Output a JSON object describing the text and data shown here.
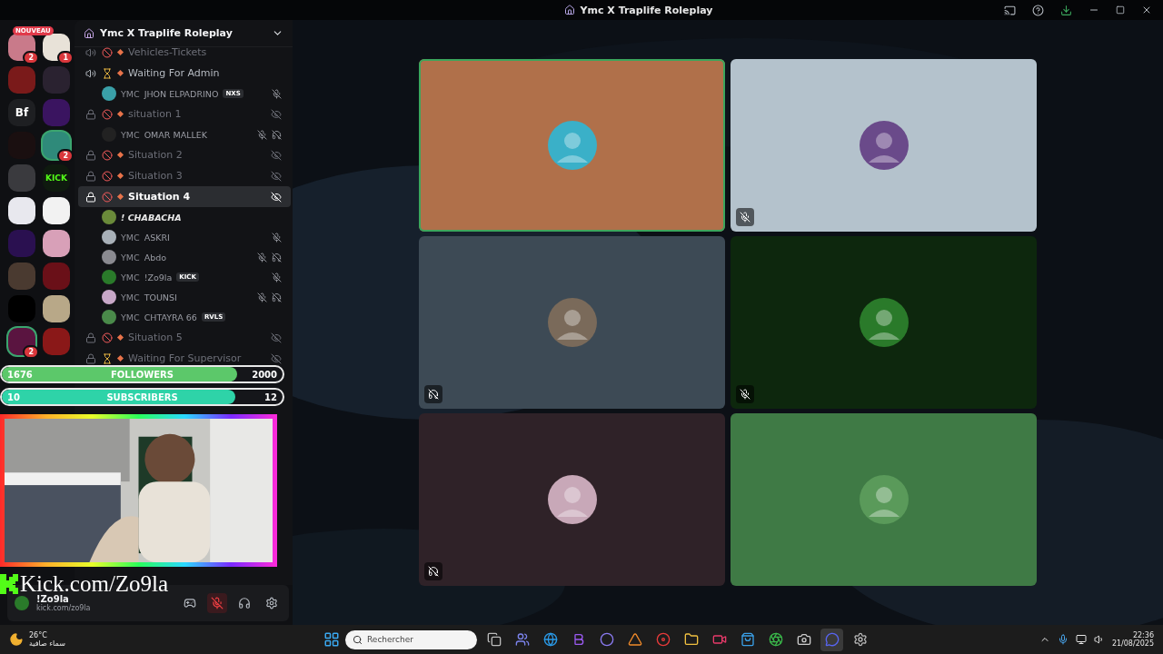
{
  "window": {
    "title": "Ymc X Traplife Roleplay"
  },
  "servers": {
    "new_badge": "NOUVEAU",
    "items": [
      {
        "color": "#c97a8a",
        "badge": "2",
        "highlighted": false
      },
      {
        "color": "#e8e2d8",
        "badge": "1",
        "highlighted": false
      },
      {
        "color": "#7a1a1a",
        "highlighted": false
      },
      {
        "color": "#2a2230",
        "highlighted": false
      },
      {
        "label": "Bf",
        "color": "#1e1f22",
        "highlighted": false
      },
      {
        "color": "#3a1460",
        "highlighted": false
      },
      {
        "color": "#1a0f10",
        "highlighted": false
      },
      {
        "color": "#2f8a7a",
        "badge": "2",
        "highlighted": true
      },
      {
        "color": "#3a3a3e",
        "highlighted": false
      },
      {
        "label": "KICK",
        "color": "#0f1a0f",
        "highlighted": false
      },
      {
        "color": "#e8e8ee",
        "highlighted": false
      },
      {
        "color": "#f2f2f2",
        "highlighted": false
      },
      {
        "color": "#2a1050",
        "highlighted": false
      },
      {
        "color": "#d8a0b8",
        "highlighted": false
      },
      {
        "color": "#4a3a30",
        "highlighted": false
      },
      {
        "color": "#6a1018",
        "highlighted": false
      },
      {
        "color": "#000000",
        "highlighted": false
      },
      {
        "color": "#b8a888",
        "highlighted": false
      },
      {
        "color": "#5a1440",
        "badge": "2",
        "highlighted": true
      },
      {
        "color": "#8a1818",
        "highlighted": false
      }
    ]
  },
  "channel_panel": {
    "title": "Ymc X Traplife Roleplay",
    "rows": [
      {
        "kind": "channel",
        "name": "Vehicles-Tickets",
        "locked": false,
        "waiting": false,
        "selected": false,
        "dim": true
      },
      {
        "kind": "channel",
        "name": "Waiting For Admin",
        "locked": false,
        "waiting": true,
        "selected": false,
        "dim": false
      },
      {
        "kind": "user",
        "tag": "YMC",
        "name": "JHON ELPADRINO",
        "badge": "NXS",
        "muted": true,
        "deafened": false,
        "color": "#3aa0a8"
      },
      {
        "kind": "channel",
        "name": "situation 1",
        "locked": true,
        "waiting": false,
        "selected": false,
        "dim": true
      },
      {
        "kind": "user",
        "tag": "YMC",
        "name": "OMAR MALLEK",
        "muted": true,
        "deafened": true,
        "color": "#222222"
      },
      {
        "kind": "channel",
        "name": "Situation 2",
        "locked": true,
        "waiting": false,
        "selected": false,
        "dim": true
      },
      {
        "kind": "channel",
        "name": "Situation 3",
        "locked": true,
        "waiting": false,
        "selected": false,
        "dim": true
      },
      {
        "kind": "channel",
        "name": "Situation 4",
        "locked": true,
        "waiting": false,
        "selected": true,
        "dim": false
      },
      {
        "kind": "user",
        "name": "! CHABACHA",
        "muted": false,
        "deafened": false,
        "color": "#6a8a3a"
      },
      {
        "kind": "user",
        "tag": "YMC",
        "name": "ASKRI",
        "muted": true,
        "deafened": false,
        "color": "#a8b0b8"
      },
      {
        "kind": "user",
        "tag": "YMC",
        "name": "Abdo",
        "muted": true,
        "deafened": true,
        "color": "#8a8a90"
      },
      {
        "kind": "user",
        "tag": "YMC",
        "name": "!Zo9la",
        "badge": "KICK",
        "muted": true,
        "deafened": false,
        "color": "#2a7a2a"
      },
      {
        "kind": "user",
        "tag": "YMC",
        "name": "TOUNSI",
        "muted": true,
        "deafened": true,
        "color": "#c8a8c8"
      },
      {
        "kind": "user",
        "tag": "YMC",
        "name": "CHTAYRA 66",
        "badge": "RVLS",
        "muted": false,
        "deafened": false,
        "color": "#4a8a4a"
      },
      {
        "kind": "channel",
        "name": "Situation 5",
        "locked": true,
        "waiting": false,
        "selected": false,
        "dim": true
      },
      {
        "kind": "channel",
        "name": "Waiting For Supervisor",
        "locked": true,
        "waiting": true,
        "selected": false,
        "dim": true
      }
    ]
  },
  "overlay": {
    "goals": [
      {
        "label": "FOLLOWERS",
        "current": "1676",
        "target": "2000",
        "level": 0.838,
        "color": "#5cc86a"
      },
      {
        "label": "SUBSCRIBERS",
        "current": "10",
        "target": "12",
        "level": 0.833,
        "color": "#2ed3a8"
      }
    ],
    "link": "Kick.com/Zo9la"
  },
  "user_panel": {
    "name": "!Zo9la",
    "status": "kick.com/zo9la",
    "muted": true
  },
  "tiles": [
    {
      "color": "#b0704a",
      "avatar": {
        "color": "#3ab0c8"
      },
      "speaking": true,
      "muted": false,
      "deafened": false
    },
    {
      "color": "#b4c2cc",
      "avatar": {
        "color": "#6a4a8a"
      },
      "speaking": false,
      "muted": true,
      "deafened": false
    },
    {
      "color": "#3d4a55",
      "avatar": {
        "color": "#7a6a5a"
      },
      "speaking": false,
      "muted": false,
      "deafened": true
    },
    {
      "color": "#0d270d",
      "avatar": {
        "color": "#2a7a2a"
      },
      "speaking": false,
      "muted": true,
      "deafened": false
    },
    {
      "color": "#2f2228",
      "avatar": {
        "color": "#c8a8b8"
      },
      "speaking": false,
      "muted": false,
      "deafened": true
    },
    {
      "color": "#3f7a45",
      "avatar": {
        "color": "#5a9a5a"
      },
      "speaking": false,
      "muted": false,
      "deafened": false
    }
  ],
  "taskbar": {
    "weather": {
      "temp": "26°C",
      "text": "سماء صافية"
    },
    "search": {
      "placeholder": "Rechercher"
    },
    "apps": [
      {
        "kind": "files",
        "selected": false
      },
      {
        "kind": "teams",
        "selected": false
      },
      {
        "kind": "browser",
        "selected": false
      },
      {
        "kind": "bold",
        "selected": false
      },
      {
        "kind": "ring",
        "selected": false
      },
      {
        "kind": "triangle",
        "selected": false
      },
      {
        "kind": "record",
        "selected": false
      },
      {
        "kind": "folder",
        "selected": false
      },
      {
        "kind": "video",
        "selected": false
      },
      {
        "kind": "store",
        "selected": false
      },
      {
        "kind": "chrome",
        "selected": false
      },
      {
        "kind": "camera",
        "selected": false
      },
      {
        "kind": "discord",
        "selected": true
      },
      {
        "kind": "settings",
        "selected": false
      }
    ],
    "time": "22:36",
    "date": "21/08/2025"
  }
}
